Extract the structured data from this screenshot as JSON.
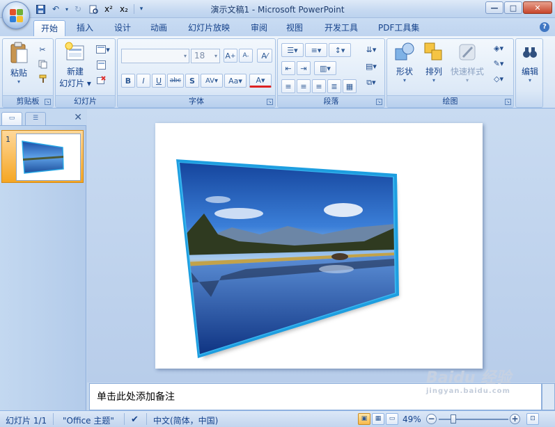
{
  "window": {
    "title": "演示文稿1 - Microsoft PowerPoint",
    "minimize_label": "—",
    "maximize_label": "□",
    "close_label": "✕"
  },
  "qat": {
    "save_icon": "save-icon",
    "undo_icon": "undo-icon",
    "redo_icon": "redo-icon",
    "superscript_label": "x²",
    "subscript_label": "x₂"
  },
  "tabs": [
    {
      "label": "开始"
    },
    {
      "label": "插入"
    },
    {
      "label": "设计"
    },
    {
      "label": "动画"
    },
    {
      "label": "幻灯片放映"
    },
    {
      "label": "审阅"
    },
    {
      "label": "视图"
    },
    {
      "label": "开发工具"
    },
    {
      "label": "PDF工具集"
    }
  ],
  "ribbon": {
    "clipboard": {
      "label": "剪贴板",
      "paste_label": "粘贴"
    },
    "slides": {
      "label": "幻灯片",
      "new_slide_label": "新建",
      "new_slide_label2": "幻灯片"
    },
    "font": {
      "label": "字体",
      "font_size": "18",
      "bold": "B",
      "italic": "I",
      "underline": "U",
      "strike": "abc",
      "shadow": "S",
      "spacing": "AV",
      "case": "Aa",
      "color": "A",
      "grow": "A",
      "shrink": "A"
    },
    "paragraph": {
      "label": "段落"
    },
    "drawing": {
      "label": "绘图",
      "shapes_label": "形状",
      "arrange_label": "排列",
      "quick_styles_label": "快速样式"
    },
    "editing": {
      "label": "编辑"
    }
  },
  "left_panel": {
    "slide_number": "1"
  },
  "notes": {
    "placeholder": "单击此处添加备注"
  },
  "watermark": {
    "text": "Baidu 经验",
    "sub": "jingyan.baidu.com"
  },
  "status": {
    "slide_info": "幻灯片 1/1",
    "theme": "\"Office 主题\"",
    "language": "中文(简体，中国)",
    "zoom": "49%",
    "zoom_out": "−",
    "zoom_in": "+"
  },
  "colors": {
    "accent": "#15428b",
    "frame_blue": "#1e9ee0"
  }
}
